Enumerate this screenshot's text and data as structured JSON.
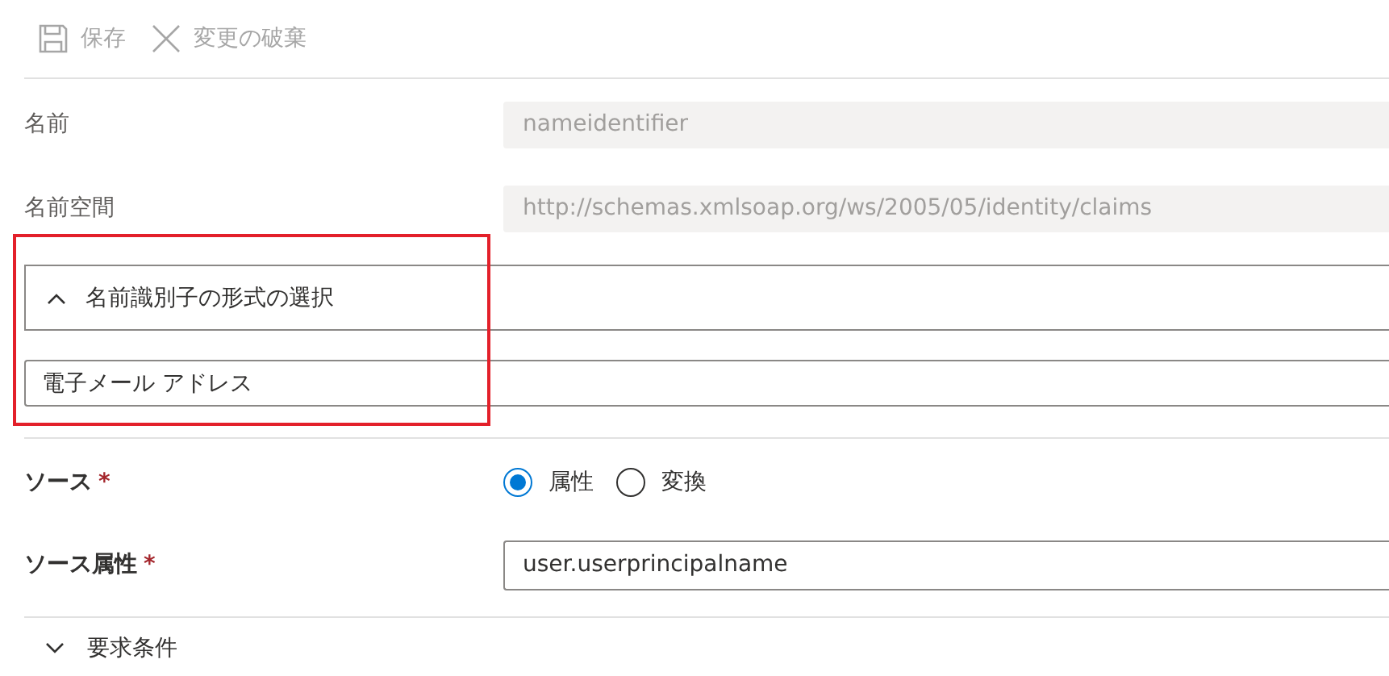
{
  "toolbar": [
    {
      "kind": "save",
      "label": "保存",
      "disabled": true
    },
    {
      "kind": "discard",
      "label": "変更の破棄",
      "disabled": true
    }
  ],
  "fields": [
    {
      "label": "名前",
      "value": "nameidentifier",
      "disabled": true
    },
    {
      "label": "名前空間",
      "value": "http://schemas.xmlsoap.org/ws/2005/05/identity/claims",
      "disabled": true
    }
  ],
  "name_id_format": {
    "title": "名前識別子の形式の選択",
    "expanded": true,
    "value": "電子メール アドレス"
  },
  "source": {
    "label": "ソース",
    "required": "*",
    "options": [
      {
        "label": "属性",
        "selected": true
      },
      {
        "label": "変換",
        "selected": false
      }
    ]
  },
  "source_attribute": {
    "label": "ソース属性",
    "required": "*",
    "value": "user.userprincipalname"
  },
  "claim_conditions": {
    "title": "要求条件",
    "expanded": false
  }
}
